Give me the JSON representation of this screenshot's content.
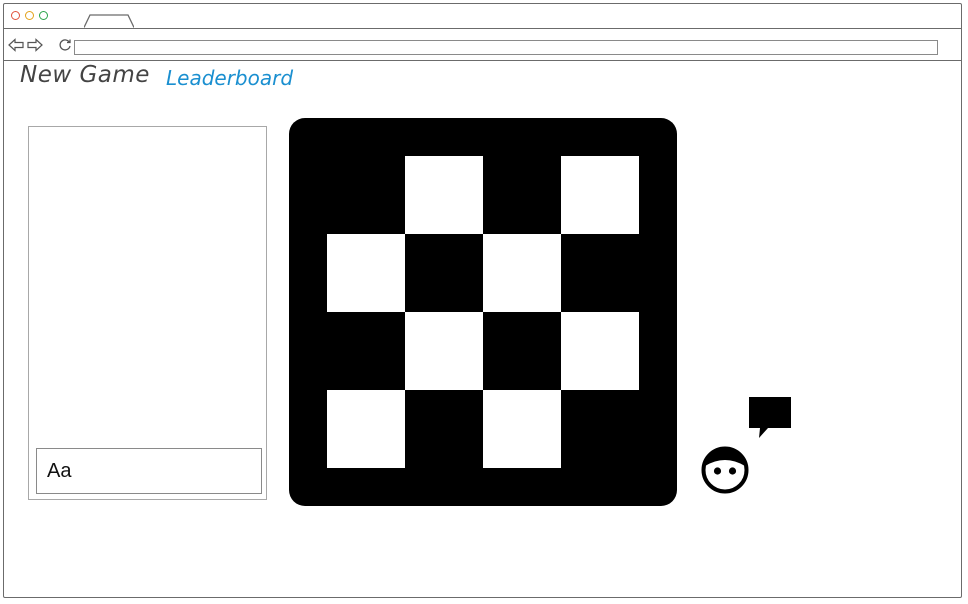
{
  "browser": {
    "url": "",
    "icons": {
      "back": "arrow-left-icon",
      "forward": "arrow-right-icon",
      "reload": "reload-icon"
    }
  },
  "menu": {
    "new_game": "New Game",
    "leaderboard": "Leaderboard"
  },
  "chat": {
    "input_placeholder": "Aa"
  },
  "board": {
    "rows": [
      [
        "dark",
        "light",
        "dark",
        "light"
      ],
      [
        "light",
        "dark",
        "light",
        "dark"
      ],
      [
        "dark",
        "light",
        "dark",
        "light"
      ],
      [
        "light",
        "dark",
        "light",
        "dark"
      ]
    ]
  },
  "player": {
    "avatar_icon": "avatar-face-icon",
    "chat_icon": "speech-bubble-icon"
  },
  "colors": {
    "leaderboard_link": "#1a8fd0",
    "board": "#000000"
  }
}
